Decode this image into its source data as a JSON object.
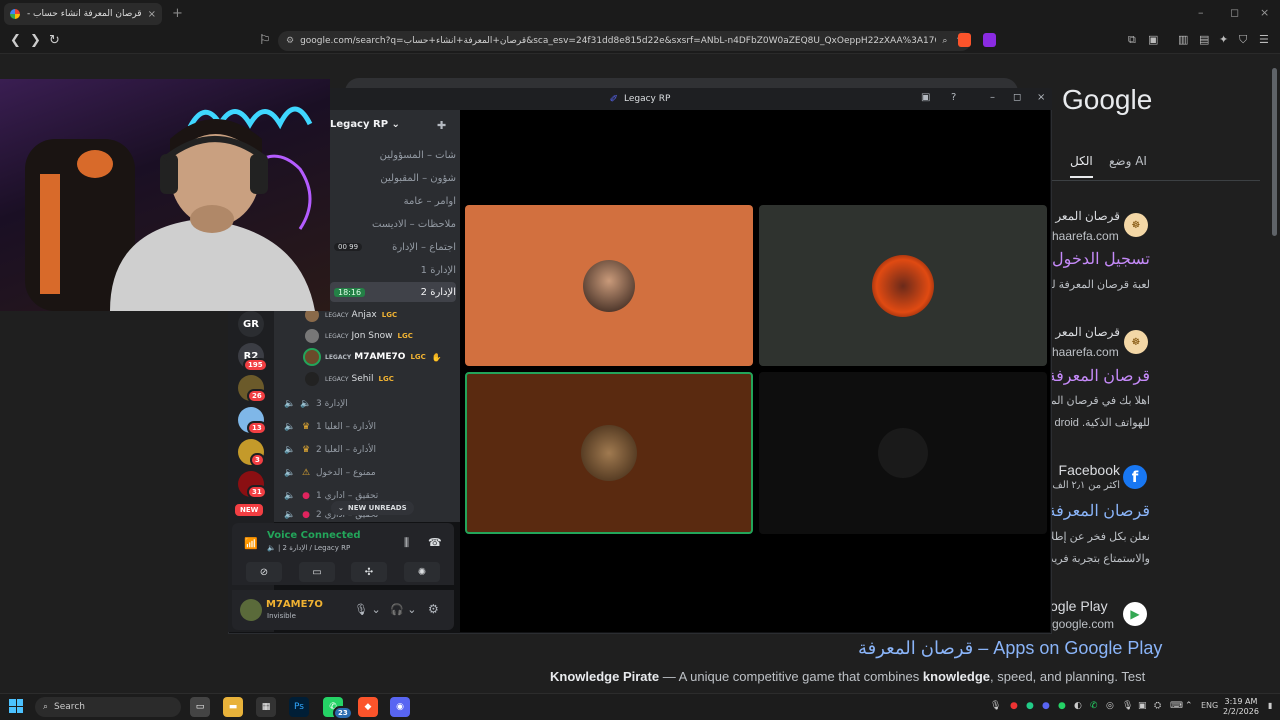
{
  "browser": {
    "tab_title": "قرصان المعرفة انشاء حساب - بحث",
    "tab_close": "×",
    "new_tab": "+",
    "window_controls": [
      "–",
      "◻",
      "×"
    ],
    "url": "google.com/search?q=قرصان+المعرفة+انشاء+حساب&sca_esv=24f31dd8e815d22e&sxsrf=ANbL-n4DFbZ0W0aZEQ8U_QxOeppH22zXAA%3A176..."
  },
  "google": {
    "logo": "Google",
    "tabs": {
      "all": "الكل",
      "ai_mode": "وضع AI"
    },
    "results": [
      {
        "site": "قرصان المعر",
        "url": "haarefa.com",
        "title": "تسجيل الدخول",
        "snippet": "لعبة قرصان المعرفة لعـ"
      },
      {
        "site": "قرصان المعر",
        "url": "haarefa.com",
        "title": "قرصان المعرفة",
        "snippet": "اهلا بك في قرصان المعـ",
        "snippet2": "للهواتف الذكية. droid"
      },
      {
        "site": "Facebook",
        "url": "أكثر من ٢٫١ ألف",
        "title": "قرصان المعرفة",
        "snippet": "نعلن بكل فخر عن إطلا",
        "snippet2": "والاستمتاع بتجربة فريد"
      },
      {
        "site": "ogle Play",
        "url": "google.com",
        "title": "قرصان المعرفة – Apps on Google Play",
        "snippet_bold": "Knowledge Pirate",
        "snippet": " — A unique competitive game that combines ",
        "snippet_bold2": "knowledge",
        "snippet_end": ", speed, and planning. Test"
      }
    ]
  },
  "discord": {
    "window_title": "Legacy RP",
    "server_name": "Legacy RP",
    "window_controls": [
      "–",
      "◻",
      "×"
    ],
    "servers": [
      {
        "label": "GR",
        "badge": ""
      },
      {
        "label": "R2",
        "badge": "195"
      },
      {
        "label": "",
        "badge": "26"
      },
      {
        "label": "",
        "badge": "13"
      },
      {
        "label": "",
        "badge": "3"
      },
      {
        "label": "",
        "badge": "31"
      }
    ],
    "new_badge": "NEW",
    "text_channels": [
      {
        "name": "شات – المسؤولين"
      },
      {
        "name": "شؤون – المقبولين"
      },
      {
        "name": "اوامر – عامة"
      },
      {
        "name": "ملاحظات – الاديست"
      },
      {
        "name": "اجتماع – الإدارة",
        "counts": "00 99"
      },
      {
        "name": "الإدارة 1"
      },
      {
        "name": "الإدارة 2",
        "time": "18:16"
      }
    ],
    "voice_users": [
      {
        "prefix": "LEGACY",
        "name": "Anjax",
        "tag": "LGC"
      },
      {
        "prefix": "LEGACY",
        "name": "Jon Snow",
        "tag": "LGC"
      },
      {
        "prefix": "LEGACY",
        "name": "M7AME7O",
        "tag": "LGC"
      },
      {
        "prefix": "LEGACY",
        "name": "Sehil",
        "tag": "LGC"
      }
    ],
    "voice_channels": [
      {
        "name": "الإدارة 3"
      },
      {
        "name": "الأدارة – العليا 1"
      },
      {
        "name": "الأدارة – العليا 2"
      },
      {
        "name": "ممنوع – الدخول"
      },
      {
        "name": "تحقيق – اداري 1"
      },
      {
        "name": "تحقيق – اداري 2"
      }
    ],
    "new_unreads": "NEW UNREADS",
    "voice_connected": "Voice Connected",
    "voice_location": "2 الإدارة / Legacy RP",
    "user": {
      "name": "M7AME7O",
      "status": "Invisible"
    }
  },
  "taskbar": {
    "search": "Search",
    "lang": "ENG",
    "time": "3:19 AM",
    "date": "2/2/2026",
    "whatsapp_badge": "23"
  },
  "colors": {
    "tile_orange": "#d2703f",
    "tile_gray": "#2f332f",
    "tile_brown": "#5a2a10",
    "speaking": "#23a55a"
  }
}
